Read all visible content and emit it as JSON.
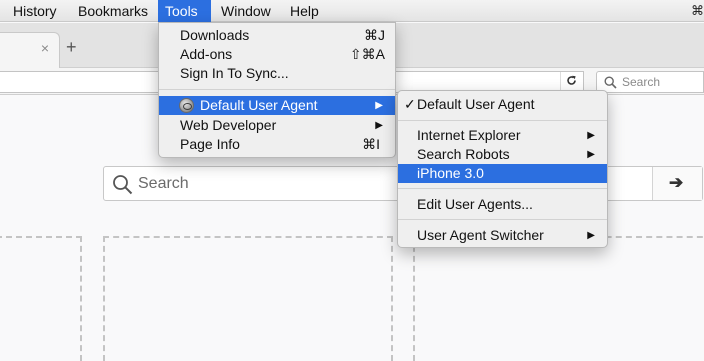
{
  "menubar": {
    "items": [
      "History",
      "Bookmarks",
      "Tools",
      "Window",
      "Help"
    ],
    "active": "Tools",
    "edge_glyph": "⌘"
  },
  "tab": {
    "close_glyph": "×",
    "new_tab_glyph": "+"
  },
  "toolbar": {
    "search_placeholder": "Search"
  },
  "page": {
    "search_placeholder": "Search",
    "go_glyph": "➔"
  },
  "tools_menu": {
    "items": [
      {
        "label": "Downloads",
        "shortcut": "⌘J"
      },
      {
        "label": "Add-ons",
        "shortcut": "⇧⌘A"
      },
      {
        "label": "Sign In To Sync..."
      },
      {
        "label": "Default User Agent",
        "icon": "user-agent-icon",
        "submenu": true,
        "highlighted": true
      },
      {
        "label": "Web Developer",
        "submenu": true
      },
      {
        "label": "Page Info",
        "shortcut": "⌘I"
      }
    ]
  },
  "ua_submenu": {
    "items": [
      {
        "label": "Default User Agent",
        "checked": true
      },
      {
        "label": "Internet Explorer",
        "submenu": true
      },
      {
        "label": "Search Robots",
        "submenu": true
      },
      {
        "label": "iPhone 3.0",
        "highlighted": true
      },
      {
        "label": "Edit User Agents..."
      },
      {
        "label": "User Agent Switcher",
        "submenu": true
      }
    ],
    "check_glyph": "✓",
    "arrow_glyph": "▶"
  },
  "colors": {
    "highlight": "#2c6fe0",
    "menu_bg": "#efefef"
  }
}
